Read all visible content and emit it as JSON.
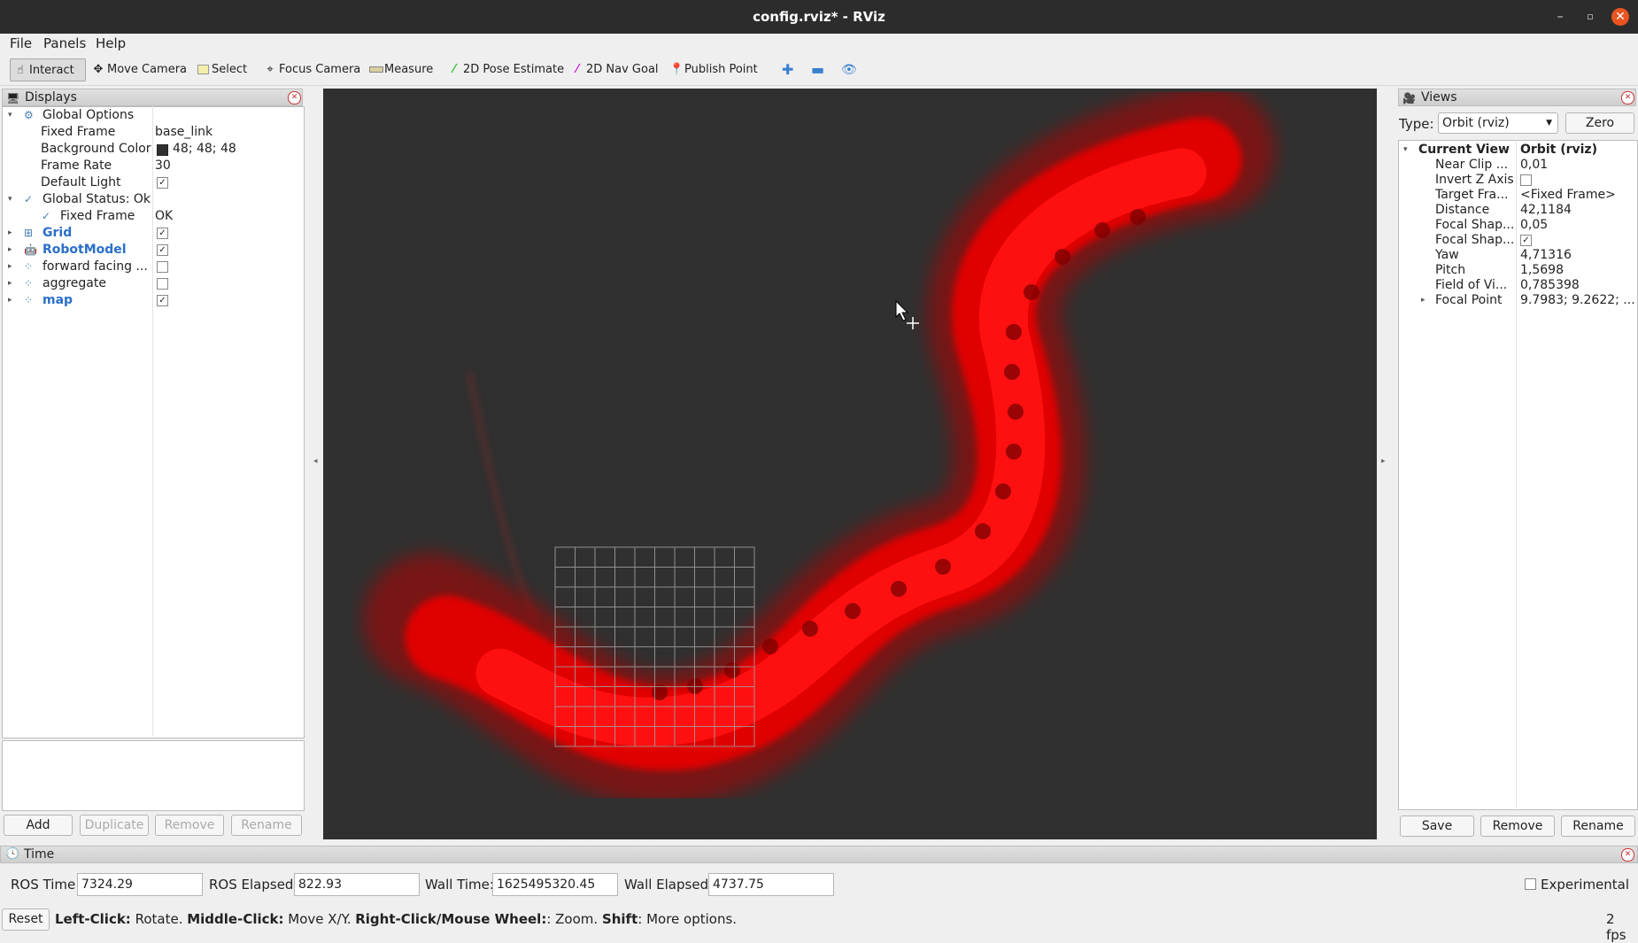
{
  "window": {
    "title": "config.rviz* - RViz"
  },
  "menu": [
    "File",
    "Panels",
    "Help"
  ],
  "toolbar": {
    "tools": [
      "Interact",
      "Move Camera",
      "Select",
      "Focus Camera",
      "Measure",
      "2D Pose Estimate",
      "2D Nav Goal",
      "Publish Point"
    ],
    "active": "Interact"
  },
  "displays": {
    "title": "Displays",
    "global_options": {
      "label": "Global Options",
      "fixed_frame_label": "Fixed Frame",
      "fixed_frame": "base_link",
      "bg_color_label": "Background Color",
      "bg_color": "48; 48; 48",
      "frame_rate_label": "Frame Rate",
      "frame_rate": "30",
      "default_light_label": "Default Light"
    },
    "global_status": {
      "label": "Global Status: Ok",
      "fixed_frame_label": "Fixed Frame",
      "fixed_frame_value": "OK"
    },
    "items": [
      {
        "label": "Grid",
        "checked": true
      },
      {
        "label": "RobotModel",
        "checked": true
      },
      {
        "label": "forward facing ...",
        "checked": false
      },
      {
        "label": "aggregate",
        "checked": false
      },
      {
        "label": "map",
        "checked": true
      }
    ],
    "buttons": {
      "add": "Add",
      "duplicate": "Duplicate",
      "remove": "Remove",
      "rename": "Rename"
    }
  },
  "views": {
    "title": "Views",
    "type_label": "Type:",
    "type_value": "Orbit (rviz)",
    "zero_label": "Zero",
    "current_view": {
      "label": "Current View",
      "value": "Orbit (rviz)"
    },
    "props": [
      {
        "name": "Near Clip ...",
        "value": "0,01"
      },
      {
        "name": "Invert Z Axis",
        "value": ""
      },
      {
        "name": "Target Fra...",
        "value": "<Fixed Frame>"
      },
      {
        "name": "Distance",
        "value": "42,1184"
      },
      {
        "name": "Focal Shap...",
        "value": "0,05"
      },
      {
        "name": "Focal Shap...",
        "value": ""
      },
      {
        "name": "Yaw",
        "value": "4,71316"
      },
      {
        "name": "Pitch",
        "value": "1,5698"
      },
      {
        "name": "Field of Vi...",
        "value": "0,785398"
      },
      {
        "name": "Focal Point",
        "value": "9.7983; 9.2622; ..."
      }
    ],
    "buttons": {
      "save": "Save",
      "remove": "Remove",
      "rename": "Rename"
    }
  },
  "time": {
    "title": "Time",
    "ros_time_label": "ROS Time:",
    "ros_time": "7324.29",
    "ros_elapsed_label": "ROS Elapsed:",
    "ros_elapsed": "822.93",
    "wall_time_label": "Wall Time:",
    "wall_time": "1625495320.45",
    "wall_elapsed_label": "Wall Elapsed:",
    "wall_elapsed": "4737.75",
    "experimental_label": "Experimental"
  },
  "status": {
    "reset": "Reset",
    "left_click": "Left-Click:",
    "left_click_desc": " Rotate. ",
    "middle_click": "Middle-Click:",
    "middle_click_desc": " Move X/Y. ",
    "right_click": "Right-Click/Mouse Wheel:",
    "right_click_desc": ": Zoom. ",
    "shift": "Shift",
    "shift_desc": ": More options.",
    "fps": "2 fps"
  },
  "colors": {
    "viewport_bg": "#303030",
    "point_cloud": "#ff0000",
    "grid": "#a0a0a0",
    "accent": "#e95420"
  }
}
